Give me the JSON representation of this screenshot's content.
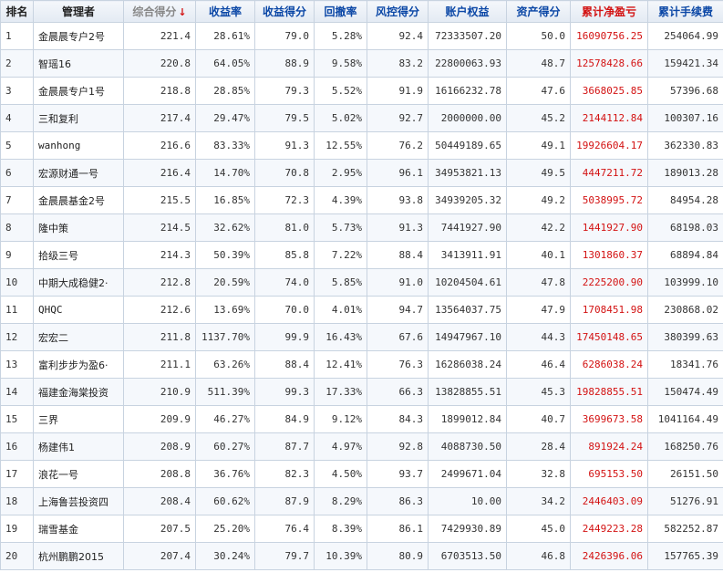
{
  "headers": {
    "rank": "排名",
    "manager": "管理者",
    "composite": "综合得分",
    "sort_arrow": "↓",
    "return_rate": "收益率",
    "return_score": "收益得分",
    "drawdown": "回撤率",
    "risk_score": "风控得分",
    "equity": "账户权益",
    "asset_score": "资产得分",
    "cum_profit": "累计净盈亏",
    "cum_fee": "累计手续费"
  },
  "colors": {
    "header_link": "#0b47a6",
    "profit_red": "#d31212",
    "border": "#c8d3e0"
  },
  "rows": [
    {
      "rank": "1",
      "manager": "金晨晨专户2号",
      "composite": "221.4",
      "return_rate": "28.61%",
      "return_score": "79.0",
      "drawdown": "5.28%",
      "risk_score": "92.4",
      "equity": "72333507.20",
      "asset_score": "50.0",
      "cum_profit": "16090756.25",
      "cum_fee": "254064.99"
    },
    {
      "rank": "2",
      "manager": "智瑶16",
      "composite": "220.8",
      "return_rate": "64.05%",
      "return_score": "88.9",
      "drawdown": "9.58%",
      "risk_score": "83.2",
      "equity": "22800063.93",
      "asset_score": "48.7",
      "cum_profit": "12578428.66",
      "cum_fee": "159421.34"
    },
    {
      "rank": "3",
      "manager": "金晨晨专户1号",
      "composite": "218.8",
      "return_rate": "28.85%",
      "return_score": "79.3",
      "drawdown": "5.52%",
      "risk_score": "91.9",
      "equity": "16166232.78",
      "asset_score": "47.6",
      "cum_profit": "3668025.85",
      "cum_fee": "57396.68"
    },
    {
      "rank": "4",
      "manager": "三和复利",
      "composite": "217.4",
      "return_rate": "29.47%",
      "return_score": "79.5",
      "drawdown": "5.02%",
      "risk_score": "92.7",
      "equity": "2000000.00",
      "asset_score": "45.2",
      "cum_profit": "2144112.84",
      "cum_fee": "100307.16"
    },
    {
      "rank": "5",
      "manager": "wanhong",
      "composite": "216.6",
      "return_rate": "83.33%",
      "return_score": "91.3",
      "drawdown": "12.55%",
      "risk_score": "76.2",
      "equity": "50449189.65",
      "asset_score": "49.1",
      "cum_profit": "19926604.17",
      "cum_fee": "362330.83"
    },
    {
      "rank": "6",
      "manager": "宏源财通一号",
      "composite": "216.4",
      "return_rate": "14.70%",
      "return_score": "70.8",
      "drawdown": "2.95%",
      "risk_score": "96.1",
      "equity": "34953821.13",
      "asset_score": "49.5",
      "cum_profit": "4447211.72",
      "cum_fee": "189013.28"
    },
    {
      "rank": "7",
      "manager": "金晨晨基金2号",
      "composite": "215.5",
      "return_rate": "16.85%",
      "return_score": "72.3",
      "drawdown": "4.39%",
      "risk_score": "93.8",
      "equity": "34939205.32",
      "asset_score": "49.2",
      "cum_profit": "5038995.72",
      "cum_fee": "84954.28"
    },
    {
      "rank": "8",
      "manager": "隆中策",
      "composite": "214.5",
      "return_rate": "32.62%",
      "return_score": "81.0",
      "drawdown": "5.73%",
      "risk_score": "91.3",
      "equity": "7441927.90",
      "asset_score": "42.2",
      "cum_profit": "1441927.90",
      "cum_fee": "68198.03"
    },
    {
      "rank": "9",
      "manager": "拾级三号",
      "composite": "214.3",
      "return_rate": "50.39%",
      "return_score": "85.8",
      "drawdown": "7.22%",
      "risk_score": "88.4",
      "equity": "3413911.91",
      "asset_score": "40.1",
      "cum_profit": "1301860.37",
      "cum_fee": "68894.84"
    },
    {
      "rank": "10",
      "manager": "中期大成稳健2·",
      "composite": "212.8",
      "return_rate": "20.59%",
      "return_score": "74.0",
      "drawdown": "5.85%",
      "risk_score": "91.0",
      "equity": "10204504.61",
      "asset_score": "47.8",
      "cum_profit": "2225200.90",
      "cum_fee": "103999.10"
    },
    {
      "rank": "11",
      "manager": "QHQC",
      "composite": "212.6",
      "return_rate": "13.69%",
      "return_score": "70.0",
      "drawdown": "4.01%",
      "risk_score": "94.7",
      "equity": "13564037.75",
      "asset_score": "47.9",
      "cum_profit": "1708451.98",
      "cum_fee": "230868.02"
    },
    {
      "rank": "12",
      "manager": "宏宏二",
      "composite": "211.8",
      "return_rate": "1137.70%",
      "return_score": "99.9",
      "drawdown": "16.43%",
      "risk_score": "67.6",
      "equity": "14947967.10",
      "asset_score": "44.3",
      "cum_profit": "17450148.65",
      "cum_fee": "380399.63"
    },
    {
      "rank": "13",
      "manager": "富利步步为盈6·",
      "composite": "211.1",
      "return_rate": "63.26%",
      "return_score": "88.4",
      "drawdown": "12.41%",
      "risk_score": "76.3",
      "equity": "16286038.24",
      "asset_score": "46.4",
      "cum_profit": "6286038.24",
      "cum_fee": "18341.76"
    },
    {
      "rank": "14",
      "manager": "福建金海棠投资",
      "composite": "210.9",
      "return_rate": "511.39%",
      "return_score": "99.3",
      "drawdown": "17.33%",
      "risk_score": "66.3",
      "equity": "13828855.51",
      "asset_score": "45.3",
      "cum_profit": "19828855.51",
      "cum_fee": "150474.49"
    },
    {
      "rank": "15",
      "manager": "三界",
      "composite": "209.9",
      "return_rate": "46.27%",
      "return_score": "84.9",
      "drawdown": "9.12%",
      "risk_score": "84.3",
      "equity": "1899012.84",
      "asset_score": "40.7",
      "cum_profit": "3699673.58",
      "cum_fee": "1041164.49"
    },
    {
      "rank": "16",
      "manager": "杨建伟1",
      "composite": "208.9",
      "return_rate": "60.27%",
      "return_score": "87.7",
      "drawdown": "4.97%",
      "risk_score": "92.8",
      "equity": "4088730.50",
      "asset_score": "28.4",
      "cum_profit": "891924.24",
      "cum_fee": "168250.76"
    },
    {
      "rank": "17",
      "manager": "浪花一号",
      "composite": "208.8",
      "return_rate": "36.76%",
      "return_score": "82.3",
      "drawdown": "4.50%",
      "risk_score": "93.7",
      "equity": "2499671.04",
      "asset_score": "32.8",
      "cum_profit": "695153.50",
      "cum_fee": "26151.50"
    },
    {
      "rank": "18",
      "manager": "上海鲁芸投资四",
      "composite": "208.4",
      "return_rate": "60.62%",
      "return_score": "87.9",
      "drawdown": "8.29%",
      "risk_score": "86.3",
      "equity": "10.00",
      "asset_score": "34.2",
      "cum_profit": "2446403.09",
      "cum_fee": "51276.91"
    },
    {
      "rank": "19",
      "manager": "瑞雪基金",
      "composite": "207.5",
      "return_rate": "25.20%",
      "return_score": "76.4",
      "drawdown": "8.39%",
      "risk_score": "86.1",
      "equity": "7429930.89",
      "asset_score": "45.0",
      "cum_profit": "2449223.28",
      "cum_fee": "582252.87"
    },
    {
      "rank": "20",
      "manager": "杭州鹏鹏2015",
      "composite": "207.4",
      "return_rate": "30.24%",
      "return_score": "79.7",
      "drawdown": "10.39%",
      "risk_score": "80.9",
      "equity": "6703513.50",
      "asset_score": "46.8",
      "cum_profit": "2426396.06",
      "cum_fee": "157765.39"
    }
  ]
}
